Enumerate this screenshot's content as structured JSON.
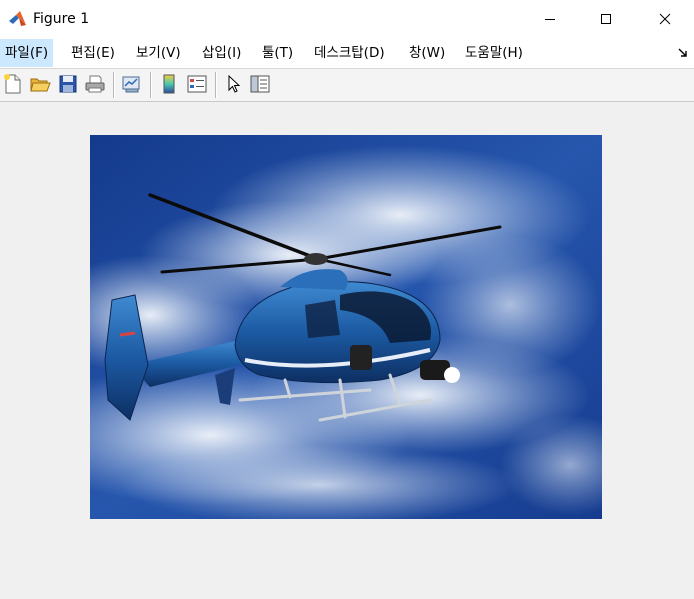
{
  "window": {
    "title": "Figure 1",
    "icon": "matlab-logo-icon"
  },
  "menubar": {
    "items": [
      {
        "label": "파일(F)",
        "active": true
      },
      {
        "label": "편집(E)"
      },
      {
        "label": "보기(V)"
      },
      {
        "label": "삽입(I)"
      },
      {
        "label": "툴(T)"
      },
      {
        "label": "데스크탑(D)"
      },
      {
        "label": "창(W)"
      },
      {
        "label": "도움말(H)"
      }
    ]
  },
  "toolbar": {
    "buttons": [
      "new-figure-icon",
      "open-file-icon",
      "save-icon",
      "print-icon",
      "link-plot-icon",
      "insert-colorbar-icon",
      "insert-legend-icon",
      "edit-plot-icon",
      "property-inspector-icon"
    ]
  },
  "figure": {
    "image_subject": "helicopter",
    "colors": {
      "sky": "#1f4fa8",
      "body": "#1d5a9e",
      "cloud": "#e6eef8"
    }
  }
}
